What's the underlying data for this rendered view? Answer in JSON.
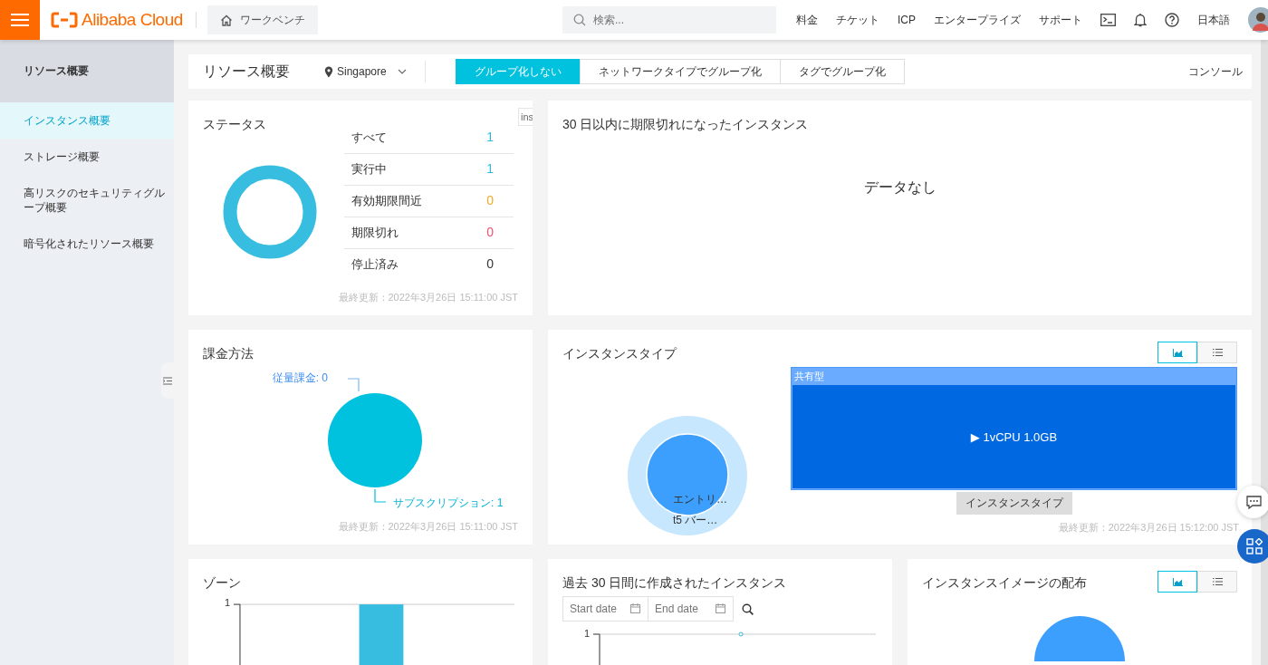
{
  "header": {
    "brand": "Alibaba Cloud",
    "workbench": "ワークベンチ",
    "search": {
      "placeholder": "検索..."
    },
    "links": [
      "料金",
      "チケット",
      "ICP",
      "エンタープライズ",
      "サポート"
    ],
    "language": "日本語"
  },
  "sidebar": {
    "title": "リソース概要",
    "items": [
      {
        "label": "インスタンス概要",
        "selected": true
      },
      {
        "label": "ストレージ概要",
        "selected": false
      },
      {
        "label": "高リスクのセキュリティグループ概要",
        "selected": false
      },
      {
        "label": "暗号化されたリソース概要",
        "selected": false
      }
    ]
  },
  "toolbar": {
    "title": "リソース概要",
    "region": "Singapore",
    "tabs": [
      {
        "label": "グループ化しない",
        "selected": true
      },
      {
        "label": "ネットワークタイプでグループ化",
        "selected": false
      },
      {
        "label": "タグでグループ化",
        "selected": false
      }
    ],
    "console": "コンソール"
  },
  "hidden_tab_fragment": "ins",
  "status_card": {
    "title": "ステータス",
    "rows": [
      {
        "label": "すべて",
        "value": "1",
        "color": "#2fb8dd"
      },
      {
        "label": "実行中",
        "value": "1",
        "color": "#2fb8dd"
      },
      {
        "label": "有効期限間近",
        "value": "0",
        "color": "#f5a623"
      },
      {
        "label": "期限切れ",
        "value": "0",
        "color": "#f0506e"
      },
      {
        "label": "停止済み",
        "value": "0",
        "color": "#333333"
      }
    ],
    "updated": "最終更新：2022年3月26日 15:11:00 JST"
  },
  "expiring_card": {
    "title": "30 日以内に期限切れになったインスタンス",
    "empty": "データなし"
  },
  "billing_card": {
    "title": "課金方法",
    "slice_labels": [
      "従量課金: 0",
      "サブスクリプション: 1"
    ],
    "updated": "最終更新：2022年3月26日 15:11:00 JST"
  },
  "instance_type_card": {
    "title": "インスタンスタイプ",
    "view_toggle": [
      {
        "kind": "chart",
        "selected": true
      },
      {
        "kind": "list",
        "selected": false
      }
    ],
    "ring_labels": [
      "エントリ…",
      "t5 バー…"
    ],
    "treemap": {
      "group": "共有型",
      "item": "▶ 1vCPU 1.0GB"
    },
    "legend_button": "インスタンスタイプ",
    "updated": "最終更新：2022年3月26日 15:12:00 JST"
  },
  "zone_card": {
    "title": "ゾーン",
    "y_tick": "1"
  },
  "created_card": {
    "title": "過去 30 日間に作成されたインスタンス",
    "start_placeholder": "Start date",
    "end_placeholder": "End date",
    "y_tick": "1"
  },
  "image_card": {
    "title": "インスタンスイメージの配布",
    "view_toggle": [
      {
        "kind": "chart",
        "selected": true
      },
      {
        "kind": "list",
        "selected": false
      }
    ]
  }
}
